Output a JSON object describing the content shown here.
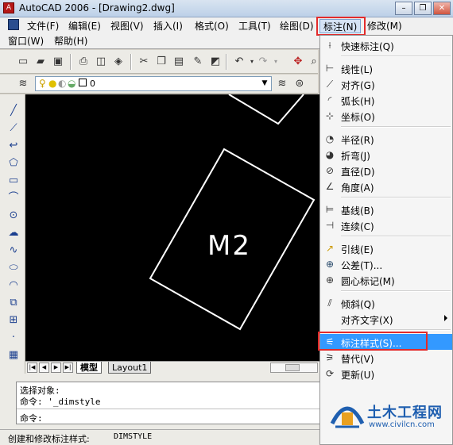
{
  "window": {
    "title": "AutoCAD 2006 - [Drawing2.dwg]",
    "app_icon": "acad-logo-icon",
    "minimize": "–",
    "restore": "❐",
    "close": "✕"
  },
  "menubar": {
    "row1": [
      "文件(F)",
      "编辑(E)",
      "视图(V)",
      "插入(I)",
      "格式(O)",
      "工具(T)",
      "绘图(D)",
      "标注(N)",
      "修改(M)"
    ],
    "row2": [
      "窗口(W)",
      "帮助(H)"
    ],
    "active_item": "标注(N)"
  },
  "layer_toolbar": {
    "current_layer": "0"
  },
  "drawing": {
    "label": "M2",
    "background": "#000000",
    "stroke": "#ffffff"
  },
  "tabs": {
    "model": "模型",
    "layout": "Layout1"
  },
  "command": {
    "line1": "选择对象:",
    "line2": "命令: '_dimstyle",
    "prompt": "命令:"
  },
  "status": {
    "text": "创建和修改标注样式:",
    "command": "DIMSTYLE"
  },
  "dimension_menu": {
    "items": [
      {
        "label": "快速标注(Q)",
        "icon": "quick-dimension-icon"
      },
      {
        "label": "线性(L)",
        "icon": "linear-icon"
      },
      {
        "label": "对齐(G)",
        "icon": "aligned-icon"
      },
      {
        "label": "弧长(H)",
        "icon": "arc-length-icon"
      },
      {
        "label": "坐标(O)",
        "icon": "ordinate-icon"
      },
      {
        "label": "半径(R)",
        "icon": "radius-icon"
      },
      {
        "label": "折弯(J)",
        "icon": "jogged-icon"
      },
      {
        "label": "直径(D)",
        "icon": "diameter-icon"
      },
      {
        "label": "角度(A)",
        "icon": "angular-icon"
      },
      {
        "label": "基线(B)",
        "icon": "baseline-icon"
      },
      {
        "label": "连续(C)",
        "icon": "continue-icon"
      },
      {
        "label": "引线(E)",
        "icon": "leader-icon"
      },
      {
        "label": "公差(T)...",
        "icon": "tolerance-icon"
      },
      {
        "label": "圆心标记(M)",
        "icon": "center-mark-icon"
      },
      {
        "label": "倾斜(Q)",
        "icon": "oblique-icon"
      },
      {
        "label": "对齐文字(X)",
        "icon": ""
      },
      {
        "label": "标注样式(S)...",
        "icon": "dimension-style-icon"
      },
      {
        "label": "替代(V)",
        "icon": "override-icon"
      },
      {
        "label": "更新(U)",
        "icon": "update-icon"
      }
    ],
    "highlighted": "标注样式(S)...",
    "highlight_color": "#3399ff"
  },
  "watermark": {
    "title": "土木工程网",
    "url": "www.civilcn.com",
    "brand_color": "#1f5fb0"
  },
  "colors": {
    "callout_red": "#e32b2b"
  }
}
